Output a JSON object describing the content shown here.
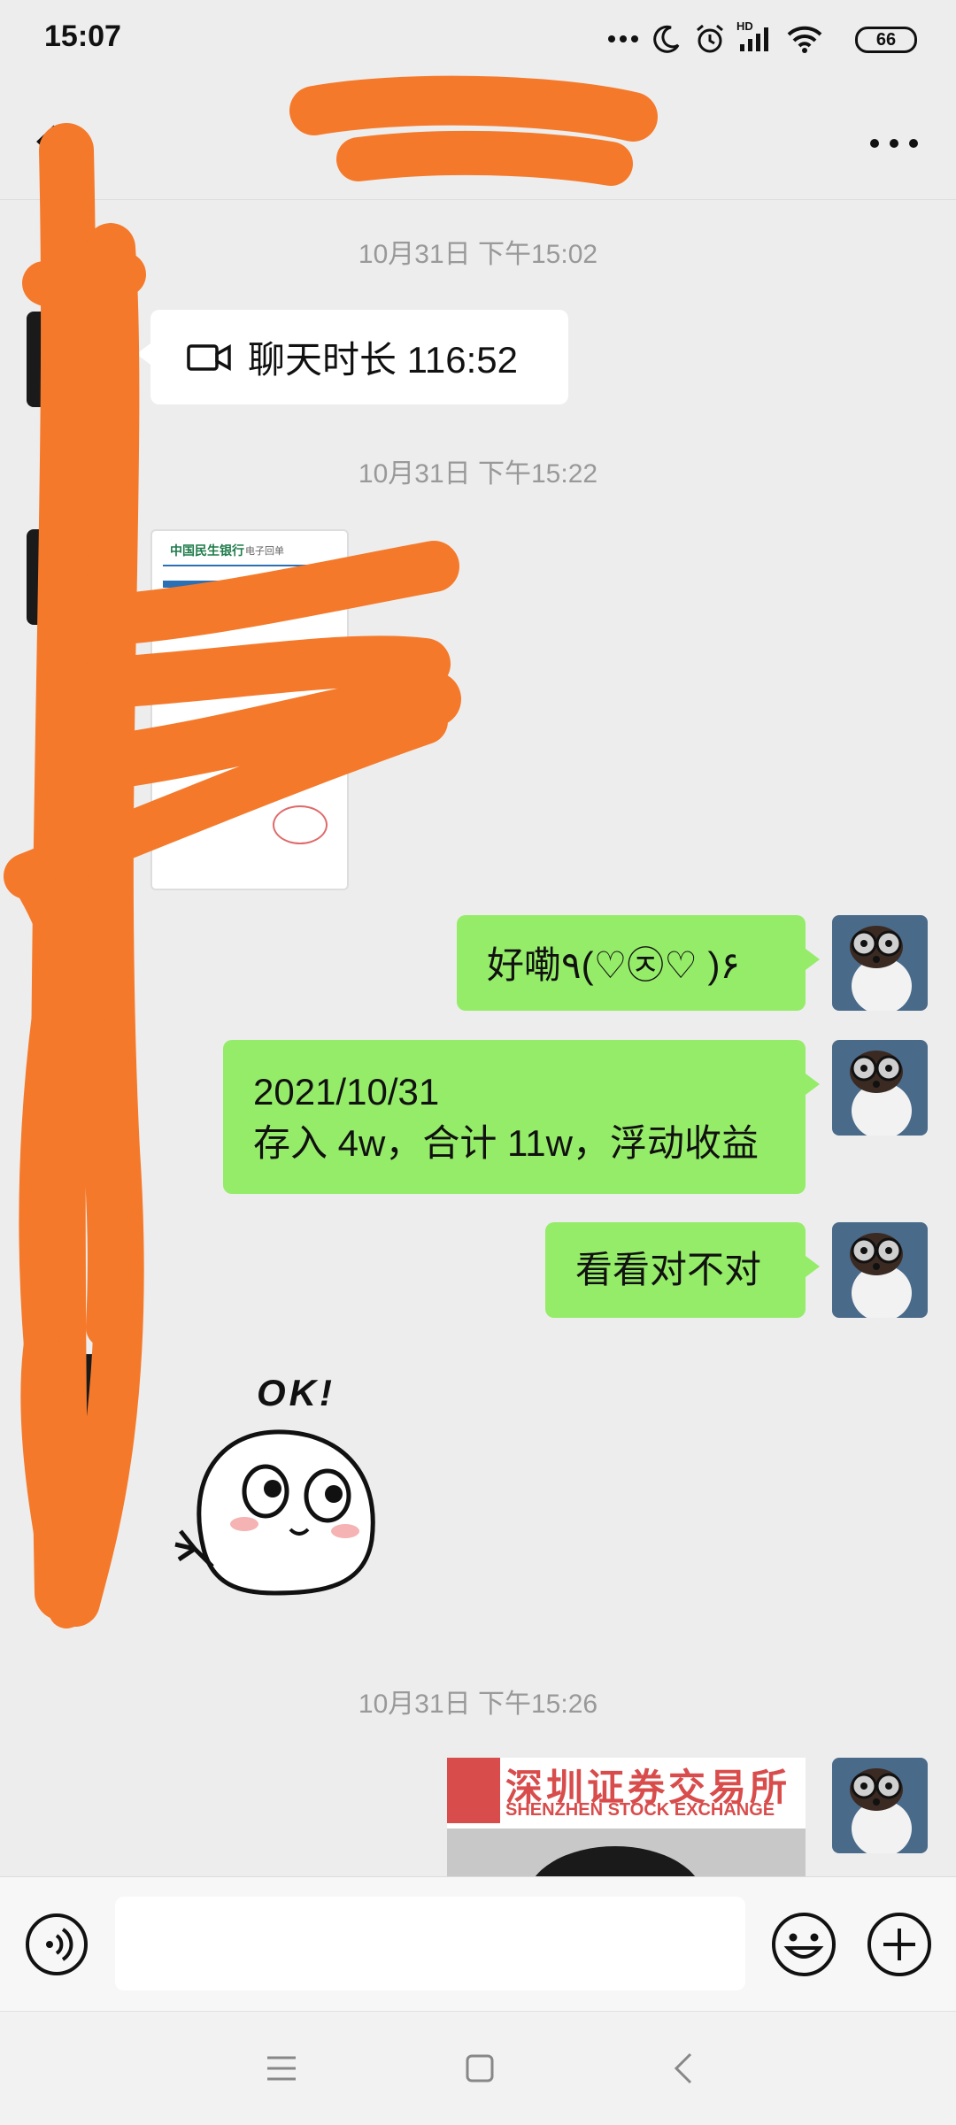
{
  "status_bar": {
    "time": "15:07",
    "battery": "66",
    "signal_label": "HD",
    "icons": [
      "more-dots-icon",
      "moon-icon",
      "alarm-icon",
      "signal-icon",
      "wifi-icon",
      "battery-icon"
    ]
  },
  "header": {
    "title": "",
    "icons": [
      "back-arrow-icon",
      "more-icon"
    ]
  },
  "messages": [
    {
      "type": "timestamp",
      "text": "10月31日 下午15:02"
    },
    {
      "type": "call",
      "side": "left",
      "icon": "video-call-icon",
      "text": "聊天时长 116:52"
    },
    {
      "type": "timestamp",
      "text": "10月31日 下午15:22"
    },
    {
      "type": "image",
      "side": "left",
      "bank_name": "中国民生银行",
      "doc_label": "电子回单"
    },
    {
      "type": "text",
      "side": "right",
      "text": "好嘞٩(♡㉨♡ )۶"
    },
    {
      "type": "text",
      "side": "right",
      "lines": [
        "2021/10/31",
        "存入 4w，合计 11w，浮动收益"
      ]
    },
    {
      "type": "text",
      "side": "right",
      "text": "看看对不对"
    },
    {
      "type": "sticker",
      "side": "left",
      "text": "OK!"
    },
    {
      "type": "timestamp",
      "text": "10月31日 下午15:26"
    },
    {
      "type": "image",
      "side": "right",
      "cn": "深圳证券交易所",
      "en": "SHENZHEN STOCK EXCHANGE"
    }
  ],
  "input_bar": {
    "value": "",
    "icons": [
      "voice-icon",
      "emoji-icon",
      "plus-icon"
    ]
  },
  "nav_bar": {
    "icons": [
      "menu-icon",
      "home-icon",
      "back-icon"
    ]
  },
  "colors": {
    "background": "#ededed",
    "sent_bubble": "#95ec69",
    "received_bubble": "#ffffff",
    "redaction": "#f5792a"
  }
}
